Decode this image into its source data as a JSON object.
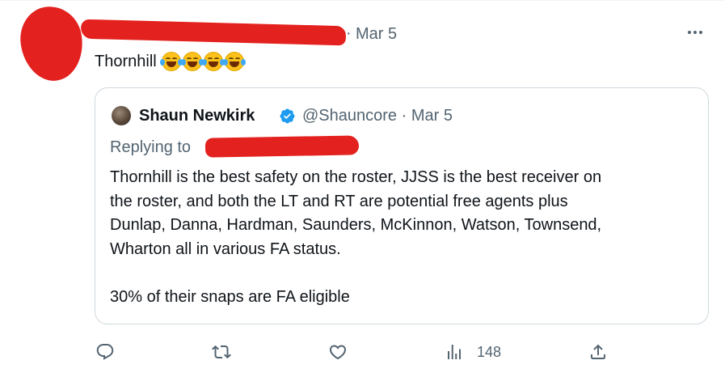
{
  "tweet": {
    "date": "Mar 5",
    "text": "Thornhill",
    "emojis": [
      "tears-of-joy",
      "tears-of-joy",
      "tears-of-joy",
      "tears-of-joy"
    ]
  },
  "quote": {
    "name": "Shaun Newkirk",
    "handle": "@Shauncore · Mar 5",
    "replying_label": "Replying to",
    "body_lines": [
      "Thornhill is the best safety on the roster, JJSS is the best receiver on",
      "the roster, and both the LT and RT are potential free agents plus",
      "Dunlap, Danna, Hardman, Saunders, McKinnon, Watson, Townsend,",
      "Wharton all in various FA status."
    ],
    "body_last": "30% of their snaps are FA eligible"
  },
  "actions": {
    "reply_icon": "reply-icon",
    "retweet_icon": "retweet-icon",
    "like_icon": "like-icon",
    "views_icon": "views-icon",
    "views_count": "148",
    "share_icon": "share-icon"
  },
  "colors": {
    "redaction": "#e3211e",
    "verified": "#1d9bf0",
    "muted": "#536471"
  }
}
